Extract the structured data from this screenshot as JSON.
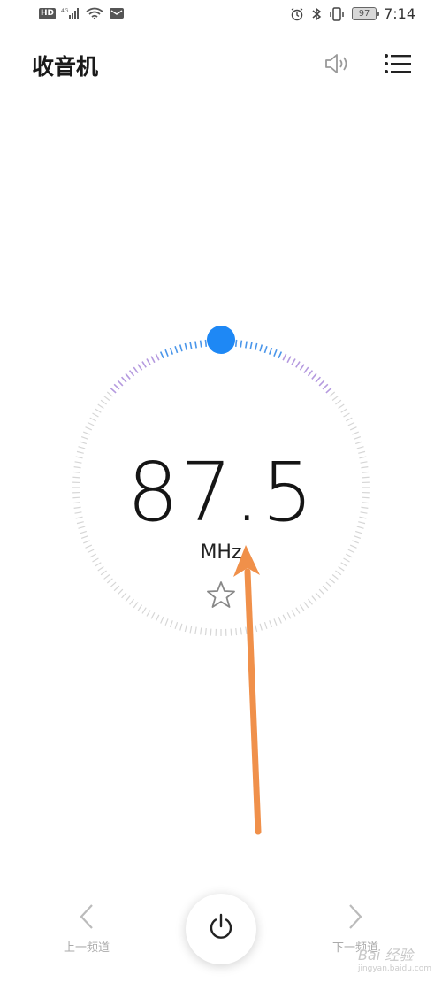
{
  "status_bar": {
    "hd": "HD",
    "network": "4G",
    "battery": "97",
    "time": "7:14"
  },
  "header": {
    "title": "收音机",
    "speaker_icon": "speaker-icon",
    "menu_icon": "menu-icon"
  },
  "tuner": {
    "frequency": "87.5",
    "unit": "MHz",
    "favorite_icon": "star-icon",
    "accent_color": "#1e88f5"
  },
  "controls": {
    "prev_label": "上一频道",
    "next_label": "下一频道",
    "power_icon": "power-icon"
  },
  "watermark": {
    "text": "Bai 经验",
    "sub": "jingyan.baidu.com"
  }
}
